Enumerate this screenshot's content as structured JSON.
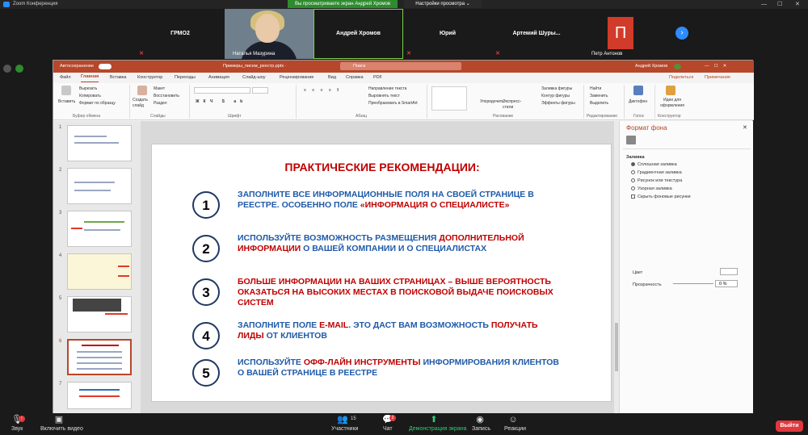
{
  "zoom": {
    "app_title": "Zoom Конференция",
    "window_controls": [
      "—",
      "☐",
      "✕"
    ],
    "share_banner": "Вы просматриваете экран Андрей Хромов",
    "view_options": "Настройки просмотра ⌄",
    "participants_strip": [
      "ГРМО2",
      "Наталья Мазурина",
      "Андрей Хромов",
      "Юрий",
      "Артемий Шуры...",
      "Петр Антонов"
    ],
    "petr_initial": "П",
    "toolbar": {
      "sound": "Звук",
      "video": "Включить видео",
      "participants": "Участники",
      "participants_count": "15",
      "chat": "Чат",
      "chat_badge": "2",
      "share": "Демонстрация экрана",
      "record": "Запись",
      "reactions": "Реакции",
      "exit": "Выйти"
    }
  },
  "ppt": {
    "autosave": "Автосохранение",
    "filename": "Примеры_писем_реестр.pptx  ·",
    "search": "Поиск",
    "user": "Андрей Хромов",
    "tabs": [
      "Файл",
      "Главная",
      "Вставка",
      "Конструктор",
      "Переходы",
      "Анимация",
      "Слайд-шоу",
      "Рецензирование",
      "Вид",
      "Справка",
      "PDF"
    ],
    "active_tab": "Главная",
    "share": "Поделиться",
    "notes": "Примечания",
    "ribbon": {
      "paste": "Вставить",
      "cut": "Вырезать",
      "copy": "Копировать",
      "format_painter": "Формат по образцу",
      "new_slide": "Создать слайд",
      "layout": "Макет",
      "reset": "Восстановить",
      "section": "Раздел",
      "direction": "Направление текста",
      "align": "Выровнять текст",
      "smartart": "Преобразовать в SmartArt",
      "arrange": "Упорядочить",
      "quick_styles": "Экспресс-стили",
      "fill": "Заливка фигуры",
      "outline": "Контур фигуры",
      "effects": "Эффекты фигуры",
      "find": "Найти",
      "replace": "Заменить",
      "select": "Выделить",
      "dictate": "Диктофон",
      "designer": "Идеи для оформления",
      "groups": [
        "Буфер обмена",
        "Слайды",
        "Шрифт",
        "Абзац",
        "Рисование",
        "Редактирование",
        "Голос",
        "Конструктор"
      ]
    },
    "thumb_numbers": [
      "1",
      "2",
      "3",
      "4",
      "5",
      "6",
      "7"
    ],
    "slide": {
      "title": "ПРАКТИЧЕСКИЕ РЕКОМЕНДАЦИИ:",
      "items": [
        {
          "num": "1",
          "parts": [
            {
              "t": "ЗАПОЛНИТЕ ВСЕ ИНФОРМАЦИОННЫЕ ПОЛЯ НА СВОЕЙ СТРАНИЦЕ В РЕЕСТРЕ. ОСОБЕННО ПОЛЕ ",
              "red": false
            },
            {
              "t": "«ИНФОРМАЦИЯ О СПЕЦИАЛИСТЕ»",
              "red": true
            }
          ]
        },
        {
          "num": "2",
          "parts": [
            {
              "t": "ИСПОЛЬЗУЙТЕ ВОЗМОЖНОСТЬ РАЗМЕЩЕНИЯ ",
              "red": false
            },
            {
              "t": "ДОПОЛНИТЕЛЬНОЙ ИНФОРМАЦИИ",
              "red": true
            },
            {
              "t": " О ВАШЕЙ КОМПАНИИ И О СПЕЦИАЛИСТАХ",
              "red": false
            }
          ]
        },
        {
          "num": "3",
          "parts": [
            {
              "t": "БОЛЬШЕ ИНФОРМАЦИИ НА ВАШИХ СТРАНИЦАХ – ВЫШЕ ВЕРОЯТНОСТЬ ОКАЗАТЬСЯ НА ВЫСОКИХ МЕСТАХ В ПОИСКОВОЙ ВЫДАЧЕ ПОИСКОВЫХ СИСТЕМ",
              "red": true
            }
          ]
        },
        {
          "num": "4",
          "parts": [
            {
              "t": "ЗАПОЛНИТЕ ПОЛЕ ",
              "red": false
            },
            {
              "t": "E-MAIL",
              "red": true
            },
            {
              "t": ". ЭТО ДАСТ ВАМ ВОЗМОЖНОСТЬ ",
              "red": false
            },
            {
              "t": "ПОЛУЧАТЬ ЛИДЫ",
              "red": true
            },
            {
              "t": " ОТ КЛИЕНТОВ",
              "red": false
            }
          ]
        },
        {
          "num": "5",
          "parts": [
            {
              "t": "ИСПОЛЬЗУЙТЕ ",
              "red": false
            },
            {
              "t": "ОФФ-ЛАЙН ИНСТРУМЕНТЫ",
              "red": true
            },
            {
              "t": " ИНФОРМИРОВАНИЯ КЛИЕНТОВ О ВАШЕЙ СТРАНИЦЕ В РЕЕСТРЕ",
              "red": false
            }
          ]
        }
      ]
    },
    "panel": {
      "title": "Формат фона",
      "fill_header": "Заливка",
      "options": [
        "Сплошная заливка",
        "Градиентная заливка",
        "Рисунок или текстура",
        "Узорная заливка"
      ],
      "hide_bg": "Скрыть фоновые рисунки",
      "color_label": "Цвет",
      "transparency_label": "Прозрачность",
      "transparency_value": "0 %"
    }
  }
}
